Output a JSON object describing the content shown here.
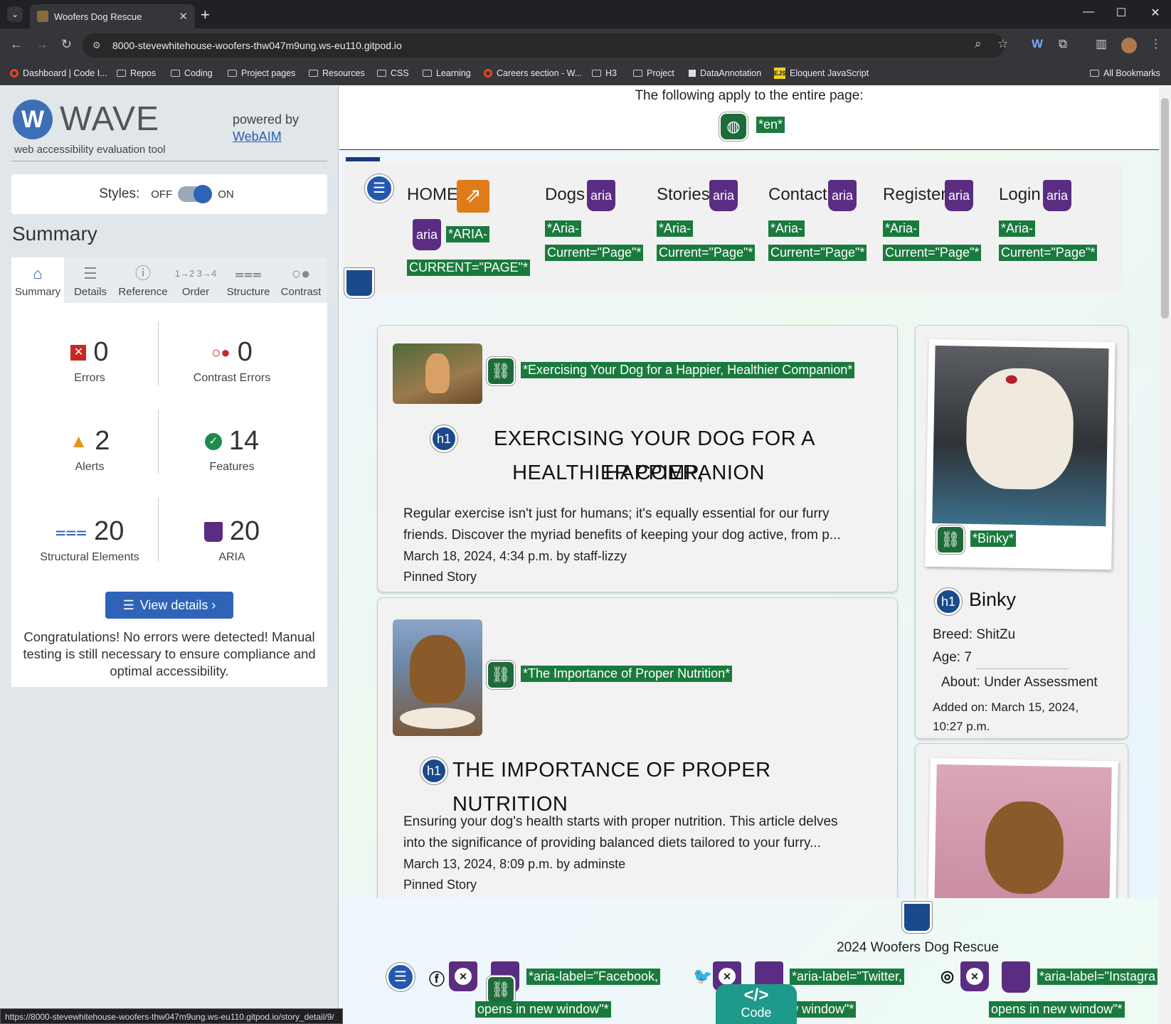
{
  "browser": {
    "tab_title": "Woofers Dog Rescue",
    "url": "8000-stevewhitehouse-woofers-thw047m9ung.ws-eu110.gitpod.io",
    "bookmarks": [
      "Dashboard | Code I...",
      "Repos",
      "Coding",
      "Project pages",
      "Resources",
      "CSS",
      "Learning",
      "Careers section - W...",
      "H3",
      "Project",
      "DataAnnotation",
      "Eloquent JavaScript"
    ],
    "all_bookmarks": "All Bookmarks",
    "status_url": "https://8000-stevewhitehouse-woofers-thw047m9ung.ws-eu110.gitpod.io/story_detail/9/"
  },
  "wave": {
    "title": "WAVE",
    "subtitle": "web accessibility evaluation tool",
    "powered_by": "powered by",
    "webaim": "WebAIM",
    "styles_label": "Styles:",
    "styles_off": "OFF",
    "styles_on": "ON",
    "summary_heading": "Summary",
    "tabs": [
      "Summary",
      "Details",
      "Reference",
      "Order",
      "Structure",
      "Contrast"
    ],
    "stats": {
      "errors": {
        "value": "0",
        "label": "Errors"
      },
      "contrast": {
        "value": "0",
        "label": "Contrast Errors"
      },
      "alerts": {
        "value": "2",
        "label": "Alerts"
      },
      "features": {
        "value": "14",
        "label": "Features"
      },
      "structural": {
        "value": "20",
        "label": "Structural Elements"
      },
      "aria": {
        "value": "20",
        "label": "ARIA"
      }
    },
    "view_details": "View details ›",
    "congrats": "Congratulations! No errors were detected! Manual testing is still necessary to ensure compliance and optimal accessibility."
  },
  "page": {
    "apply_text": "The following apply to the entire page:",
    "lang_tag": "*en*",
    "aria_icon": "aria",
    "nav": {
      "home": "HOME",
      "home_tag_1": "*ARIA-",
      "home_tag_2": "CURRENT=\"PAGE\"*",
      "items": [
        "Dogs",
        "Stories",
        "Contact",
        "Register",
        "Login"
      ],
      "tag_1": "*Aria-",
      "tag_2": "Current=\"Page\"*"
    },
    "stories": [
      {
        "link_tag": "*Exercising Your Dog for a Happier, Healthier Companion*",
        "title_line1": "EXERCISING YOUR DOG FOR A HAPPIER,",
        "title_line2": "HEALTHIER COMPANION",
        "excerpt_line1": "Regular exercise isn't just for humans; it's equally essential for our furry",
        "excerpt_line2": "friends. Discover the myriad benefits of keeping your dog active, from p...",
        "meta": "March 18, 2024, 4:34 p.m. by staff-lizzy",
        "pinned": "Pinned Story"
      },
      {
        "link_tag": "*The Importance of Proper Nutrition*",
        "title_line1": "THE IMPORTANCE OF PROPER NUTRITION",
        "excerpt_line1": "Ensuring your dog's health starts with proper nutrition. This article delves",
        "excerpt_line2": "into the significance of providing balanced diets tailored to your furry...",
        "meta": "March 13, 2024, 8:09 p.m. by adminste",
        "pinned": "Pinned Story"
      }
    ],
    "dog": {
      "link_tag": "*Binky*",
      "name": "Binky",
      "breed": "Breed: ShitZu",
      "age": "Age: 7",
      "about": "About: Under Assessment",
      "added_1": "Added on: March 15, 2024,",
      "added_2": "10:27 p.m."
    },
    "footer": {
      "copyright": "2024 Woofers Dog Rescue",
      "fb_tag_1": "*aria-label=\"Facebook,",
      "fb_tag_2": "opens in new window\"*",
      "tw_tag_1": "*aria-label=\"Twitter,",
      "tw_tag_2": "w window\"*",
      "ig_tag_1": "*aria-label=\"Instagra",
      "ig_tag_2": "opens in new window\"*",
      "code_label": "Code",
      "code_glyph": "</>"
    }
  },
  "colors": {
    "wave_blue": "#2e63b8",
    "tag_green": "#1a7a3d",
    "aria_purple": "#5a2d82"
  }
}
